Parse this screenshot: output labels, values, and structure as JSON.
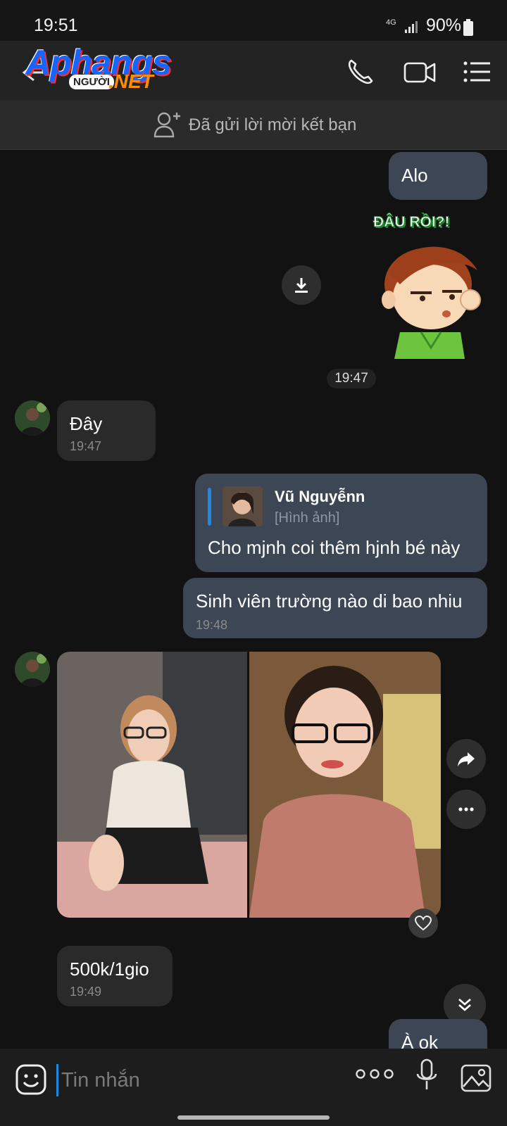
{
  "status_bar": {
    "time": "19:51",
    "network": "4G",
    "battery": "90%"
  },
  "header": {
    "logo_text": "Aphangs",
    "logo_sub_badge": "NGƯỜI",
    "logo_sub_net": ".NET"
  },
  "banner": {
    "text": "Đã gửi lời mời kết bạn"
  },
  "messages": {
    "alo": "Alo",
    "sticker_text": "ĐÂU RỒI?!",
    "sticker_time": "19:47",
    "day": {
      "text": "Đây",
      "time": "19:47"
    },
    "reply": {
      "quote_name": "Vũ Nguyễnn",
      "quote_type": "[Hình ảnh]",
      "text": "Cho mjnh coi thêm hjnh bé này"
    },
    "student": {
      "text": "Sinh viên trường nào di bao nhiu",
      "time": "19:48"
    },
    "price": {
      "text": "500k/1gio",
      "time": "19:49"
    },
    "ok": "À ok"
  },
  "composer": {
    "placeholder": "Tin nhắn"
  },
  "colors": {
    "accent": "#1e88e5",
    "outgoing": "#3d4654",
    "incoming": "#2a2a2a"
  }
}
